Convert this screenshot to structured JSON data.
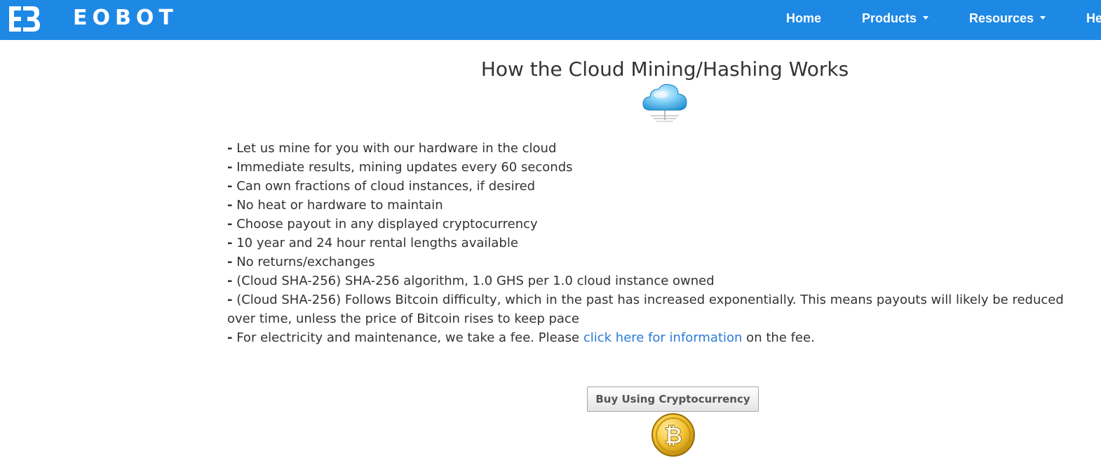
{
  "navbar": {
    "brand": "EOBOT",
    "background_color": "#1e88e5",
    "logo_icon": "eobot-logo-icon",
    "items": [
      {
        "label": "Home",
        "dropdown": false
      },
      {
        "label": "Products",
        "dropdown": true
      },
      {
        "label": "Resources",
        "dropdown": true
      },
      {
        "label": "He",
        "dropdown": false
      }
    ]
  },
  "main": {
    "title": "How the Cloud Mining/Hashing Works",
    "title_icon": "cloud-icon",
    "bullet": "-",
    "features": [
      "Let us mine for you with our hardware in the cloud",
      "Immediate results, mining updates every 60 seconds",
      "Can own fractions of cloud instances, if desired",
      "No heat or hardware to maintain",
      "Choose payout in any displayed cryptocurrency",
      "10 year and 24 hour rental lengths available",
      "No returns/exchanges",
      "(Cloud SHA-256) SHA-256 algorithm, 1.0 GHS per 1.0 cloud instance owned",
      "(Cloud SHA-256) Follows Bitcoin difficulty, which in the past has increased exponentially. This means payouts will likely be reduced over time, unless the price of Bitcoin rises to keep pace"
    ],
    "fee_note": {
      "before": "For electricity and maintenance, we take a fee. Please ",
      "link": "click here for information",
      "after": " on the fee."
    },
    "link_color": "#2a7bd8",
    "buy_button_label": "Buy Using Cryptocurrency",
    "buy_icon": "bitcoin-icon"
  }
}
